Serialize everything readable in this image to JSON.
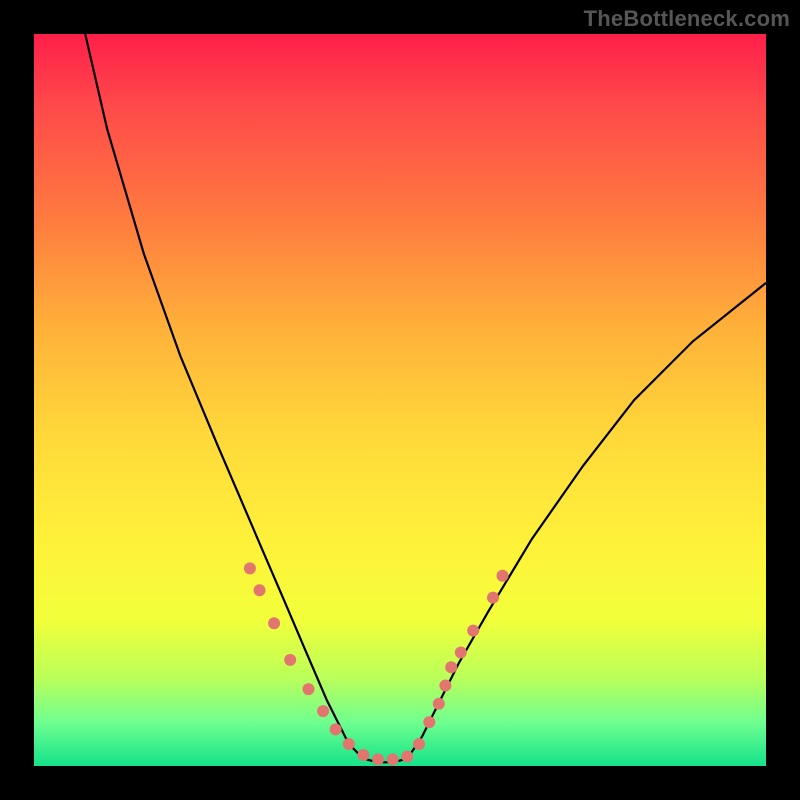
{
  "watermark": "TheBottleneck.com",
  "chart_data": {
    "type": "line",
    "title": "",
    "xlabel": "",
    "ylabel": "",
    "xlim": [
      0,
      100
    ],
    "ylim": [
      0,
      100
    ],
    "grid": false,
    "legend": false,
    "background": "rainbow-vertical-gradient",
    "series": [
      {
        "name": "left-branch",
        "x": [
          7,
          10,
          15,
          20,
          25,
          28,
          31,
          34,
          37,
          40,
          43,
          45
        ],
        "y": [
          100,
          87,
          70,
          56,
          44,
          37,
          30,
          23,
          16,
          9,
          3,
          1
        ]
      },
      {
        "name": "flat-bottom",
        "x": [
          45,
          47,
          49,
          51
        ],
        "y": [
          1,
          0.5,
          0.5,
          1
        ]
      },
      {
        "name": "right-branch",
        "x": [
          51,
          53,
          55,
          58,
          62,
          68,
          75,
          82,
          90,
          100
        ],
        "y": [
          1,
          4,
          8,
          14,
          21,
          31,
          41,
          50,
          58,
          66
        ]
      }
    ],
    "markers": [
      {
        "x": 29.5,
        "y": 27
      },
      {
        "x": 30.8,
        "y": 24
      },
      {
        "x": 32.8,
        "y": 19.5
      },
      {
        "x": 35.0,
        "y": 14.5
      },
      {
        "x": 37.5,
        "y": 10.5
      },
      {
        "x": 39.5,
        "y": 7.5
      },
      {
        "x": 41.2,
        "y": 5
      },
      {
        "x": 43.0,
        "y": 3
      },
      {
        "x": 45.0,
        "y": 1.5
      },
      {
        "x": 47.0,
        "y": 0.9
      },
      {
        "x": 49.0,
        "y": 0.9
      },
      {
        "x": 51.0,
        "y": 1.3
      },
      {
        "x": 52.6,
        "y": 3
      },
      {
        "x": 54.0,
        "y": 6
      },
      {
        "x": 55.3,
        "y": 8.5
      },
      {
        "x": 56.2,
        "y": 11
      },
      {
        "x": 57.0,
        "y": 13.5
      },
      {
        "x": 58.3,
        "y": 15.5
      },
      {
        "x": 60.0,
        "y": 18.5
      },
      {
        "x": 62.7,
        "y": 23
      },
      {
        "x": 64.0,
        "y": 26
      }
    ],
    "marker_style": {
      "color": "#e2766f",
      "radius": 6
    }
  }
}
